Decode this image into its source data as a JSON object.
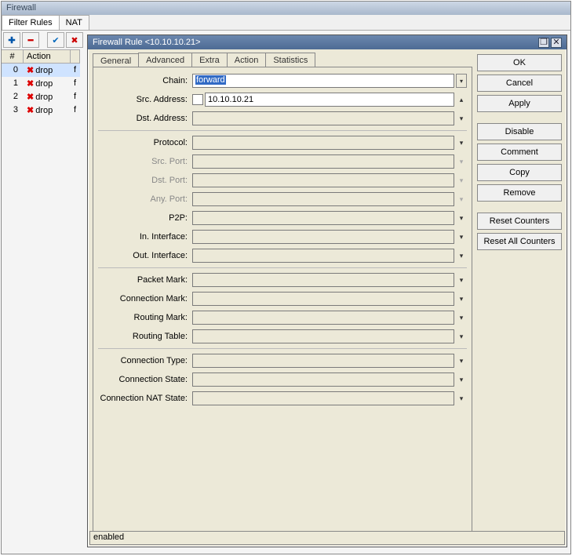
{
  "outer": {
    "title": "Firewall",
    "tabs": [
      "Filter Rules",
      "NAT"
    ]
  },
  "toolbar_icons": {
    "add": "✚",
    "remove": "━",
    "check": "✔",
    "x": "✖"
  },
  "table": {
    "headers": {
      "num": "#",
      "action": "Action"
    },
    "rows": [
      {
        "idx": "0",
        "action": "drop",
        "sel": true
      },
      {
        "idx": "1",
        "action": "drop",
        "sel": false
      },
      {
        "idx": "2",
        "action": "drop",
        "sel": false
      },
      {
        "idx": "3",
        "action": "drop",
        "sel": false
      }
    ]
  },
  "dialog": {
    "title": "Firewall Rule <10.10.10.21>",
    "tabs": [
      "General",
      "Advanced",
      "Extra",
      "Action",
      "Statistics"
    ],
    "buttons": {
      "ok": "OK",
      "cancel": "Cancel",
      "apply": "Apply",
      "disable": "Disable",
      "comment": "Comment",
      "copy": "Copy",
      "remove": "Remove",
      "reset_counters": "Reset Counters",
      "reset_all": "Reset All Counters"
    },
    "status": "enabled",
    "labels": {
      "chain": "Chain:",
      "src_addr": "Src. Address:",
      "dst_addr": "Dst. Address:",
      "protocol": "Protocol:",
      "src_port": "Src. Port:",
      "dst_port": "Dst. Port:",
      "any_port": "Any. Port:",
      "p2p": "P2P:",
      "in_if": "In. Interface:",
      "out_if": "Out. Interface:",
      "packet_mark": "Packet Mark:",
      "conn_mark": "Connection Mark:",
      "routing_mark": "Routing Mark:",
      "routing_table": "Routing Table:",
      "conn_type": "Connection Type:",
      "conn_state": "Connection State:",
      "conn_nat": "Connection NAT State:"
    },
    "values": {
      "chain": "forward",
      "src_addr": "10.10.10.21",
      "dst_addr": "",
      "protocol": "",
      "src_port": "",
      "dst_port": "",
      "any_port": "",
      "p2p": "",
      "in_if": "",
      "out_if": "",
      "packet_mark": "",
      "conn_mark": "",
      "routing_mark": "",
      "routing_table": "",
      "conn_type": "",
      "conn_state": "",
      "conn_nat": ""
    }
  }
}
